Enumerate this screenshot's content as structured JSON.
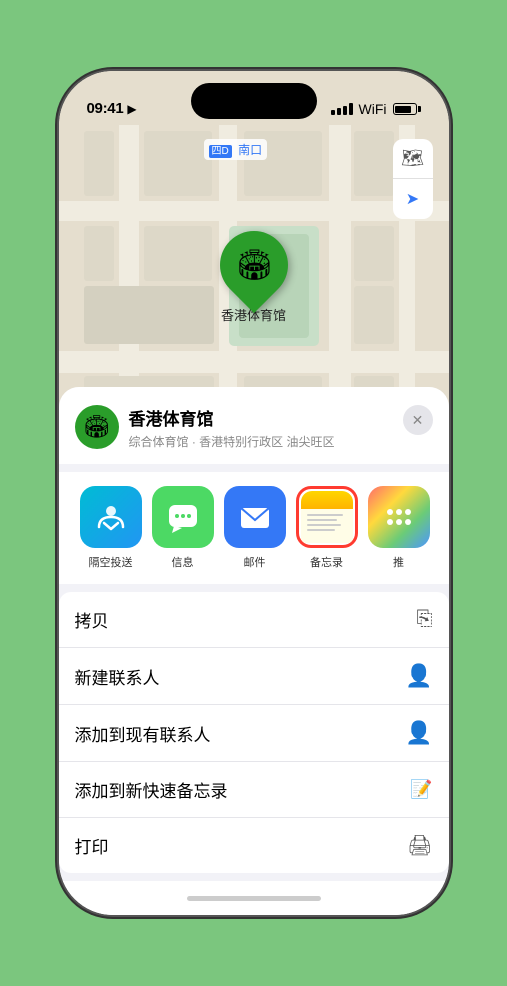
{
  "status_bar": {
    "time": "09:41",
    "location_icon": "▶"
  },
  "map": {
    "label": "南口",
    "location_name": "香港体育馆",
    "location_subtitle": "综合体育馆 · 香港特别行政区 油尖旺区"
  },
  "controls": {
    "map_type": "🗺",
    "location": "➤"
  },
  "share_row": [
    {
      "id": "airdrop",
      "label": "隔空投送",
      "icon": "airdrop"
    },
    {
      "id": "messages",
      "label": "信息",
      "icon": "messages"
    },
    {
      "id": "mail",
      "label": "邮件",
      "icon": "mail"
    },
    {
      "id": "notes",
      "label": "备忘录",
      "icon": "notes",
      "selected": true
    },
    {
      "id": "more",
      "label": "推",
      "icon": "more"
    }
  ],
  "actions": [
    {
      "id": "copy",
      "label": "拷贝",
      "icon": "copy"
    },
    {
      "id": "new-contact",
      "label": "新建联系人",
      "icon": "new-contact"
    },
    {
      "id": "add-existing",
      "label": "添加到现有联系人",
      "icon": "add-existing"
    },
    {
      "id": "add-notes",
      "label": "添加到新快速备忘录",
      "icon": "add-notes"
    },
    {
      "id": "print",
      "label": "打印",
      "icon": "print"
    }
  ],
  "place": {
    "name": "香港体育馆",
    "subtitle": "综合体育馆 · 香港特别行政区 油尖旺区",
    "icon": "🏟"
  }
}
